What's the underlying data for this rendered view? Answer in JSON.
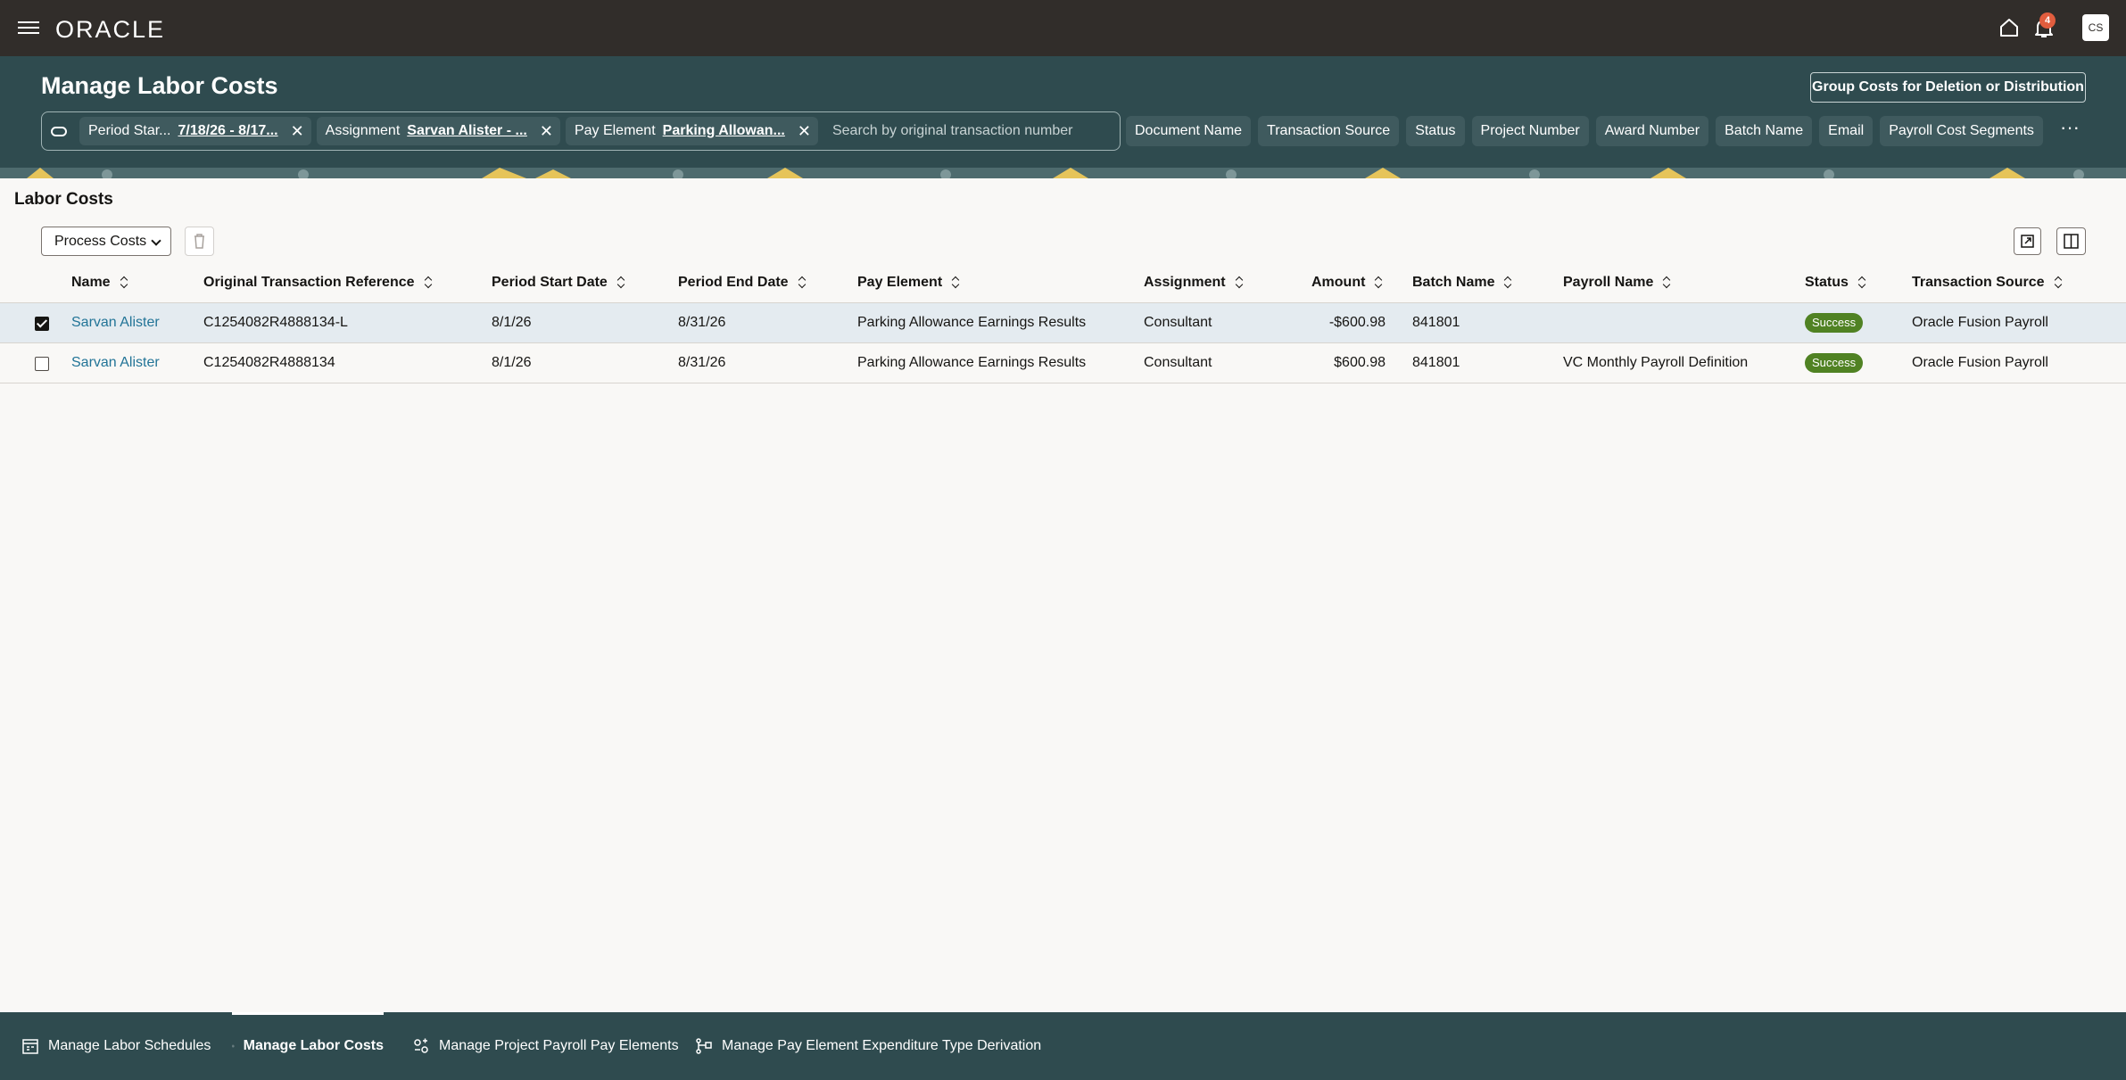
{
  "app": {
    "logo": "ORACLE",
    "notifications_count": "4",
    "user_initials": "CS"
  },
  "header": {
    "title": "Manage Labor Costs",
    "group_button": "Group Costs for Deletion or Distribution",
    "chips": [
      {
        "label": "Period Star...",
        "value": "7/18/26 - 8/17..."
      },
      {
        "label": "Assignment",
        "value": "Sarvan Alister - ..."
      },
      {
        "label": "Pay Element",
        "value": "Parking Allowan..."
      }
    ],
    "search_placeholder": "Search by original transaction number",
    "filters": [
      "Document Name",
      "Transaction Source",
      "Status",
      "Project Number",
      "Award Number",
      "Batch Name",
      "Email",
      "Payroll Cost Segments"
    ],
    "more": "···"
  },
  "section": {
    "title": "Labor Costs",
    "process_button": "Process Costs"
  },
  "table": {
    "columns": [
      "Name",
      "Original Transaction Reference",
      "Period Start Date",
      "Period End Date",
      "Pay Element",
      "Assignment",
      "Amount",
      "Batch Name",
      "Payroll Name",
      "Status",
      "Transaction Source"
    ],
    "rows": [
      {
        "selected": true,
        "name": "Sarvan Alister",
        "reference": "C1254082R4888134-L",
        "start": "8/1/26",
        "end": "8/31/26",
        "pay_element": "Parking Allowance Earnings Results",
        "assignment": "Consultant",
        "amount": "-$600.98",
        "batch": "841801",
        "payroll": "",
        "status": "Success",
        "source": "Oracle Fusion Payroll"
      },
      {
        "selected": false,
        "name": "Sarvan Alister",
        "reference": "C1254082R4888134",
        "start": "8/1/26",
        "end": "8/31/26",
        "pay_element": "Parking Allowance Earnings Results",
        "assignment": "Consultant",
        "amount": "$600.98",
        "batch": "841801",
        "payroll": "VC Monthly Payroll Definition",
        "status": "Success",
        "source": "Oracle Fusion Payroll"
      }
    ]
  },
  "bottom_tabs": [
    {
      "label": "Manage Labor Schedules",
      "active": false
    },
    {
      "label": "Manage Labor Costs",
      "active": true
    },
    {
      "label": "Manage Project Payroll Pay Elements",
      "active": false
    },
    {
      "label": "Manage Pay Element Expenditure Type Derivation",
      "active": false
    }
  ],
  "colors": {
    "topbar": "#312d2a",
    "header": "#2f4b4f",
    "link": "#227497",
    "success": "#508223",
    "selected_row": "#e4ebf0"
  }
}
